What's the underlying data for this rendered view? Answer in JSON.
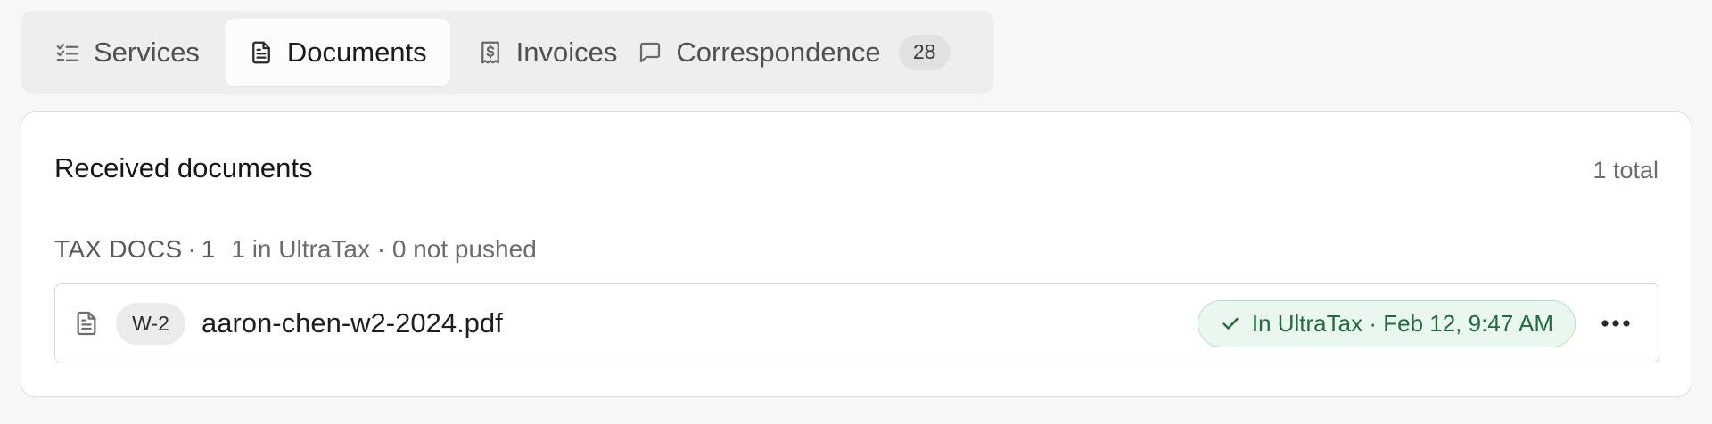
{
  "tabs": [
    {
      "label": "Services",
      "icon": "checklist-icon"
    },
    {
      "label": "Documents",
      "icon": "document-icon",
      "active": true
    },
    {
      "label": "Invoices",
      "icon": "receipt-dollar-icon"
    },
    {
      "label": "Correspondence",
      "icon": "chat-bubble-icon",
      "badge": "28"
    }
  ],
  "card": {
    "title": "Received documents",
    "total": "1 total",
    "group": {
      "name": "TAX DOCS",
      "sep": "·",
      "count": "1",
      "summary": "1 in UltraTax · 0 not pushed",
      "items": [
        {
          "type": "W-2",
          "filename": "aaron-chen-w2-2024.pdf",
          "status": "In UltraTax · Feb 12, 9:47 AM",
          "file_icon": "file-text-icon",
          "status_icon": "check-icon",
          "more_icon": "more-horizontal-icon"
        }
      ]
    }
  },
  "colors": {
    "background": "#f8f7f6",
    "tabbar": "#eeeeef",
    "active_tab": "#fcfcfc",
    "status_bg": "#e9f7ee",
    "status_border": "#b7e3c5",
    "status_text": "#1f6d3f"
  }
}
